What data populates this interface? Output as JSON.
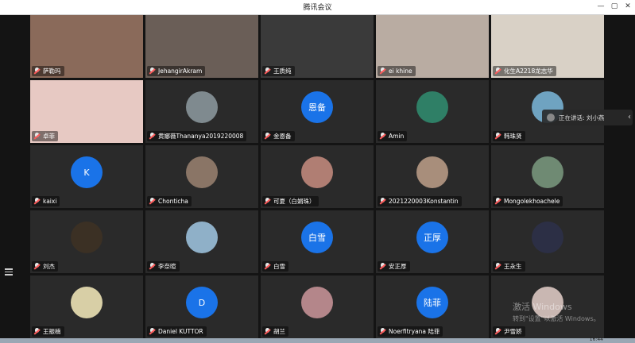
{
  "window": {
    "title": "腾讯会议",
    "min": "—",
    "max": "▢",
    "close": "✕"
  },
  "speaking": {
    "label": "正在讲话: 刘小燕"
  },
  "watermark": {
    "line1": "激活 Windows",
    "line2": "转到\"设置\"以激活 Windows。"
  },
  "clock": "16:44",
  "participants": [
    {
      "name": "萨勒玛",
      "kind": "video",
      "bg": "#8a6a5a"
    },
    {
      "name": "JehangirAkram",
      "kind": "video",
      "bg": "#6a5e57"
    },
    {
      "name": "王质纯",
      "kind": "video",
      "bg": "#3a3a3a"
    },
    {
      "name": "ei khine",
      "kind": "video",
      "bg": "#b9aca2"
    },
    {
      "name": "化生A2218龙志华",
      "kind": "video",
      "bg": "#d9d1c6"
    },
    {
      "name": "卓菲",
      "kind": "video",
      "bg": "#e7c9c3"
    },
    {
      "name": "黄娜薇Thananya2019220008",
      "kind": "photo",
      "color": "#7f8a8f"
    },
    {
      "name": "金恩备",
      "kind": "text",
      "text": "恩备"
    },
    {
      "name": "Amin",
      "kind": "photo",
      "color": "#2f7f66"
    },
    {
      "name": "韩珠贤",
      "kind": "photo",
      "color": "#6fa3c1"
    },
    {
      "name": "kaixi",
      "kind": "text",
      "text": "K"
    },
    {
      "name": "Chonticha",
      "kind": "photo",
      "color": "#8a7566"
    },
    {
      "name": "可夏（白娟珠）",
      "kind": "photo",
      "color": "#b07e73"
    },
    {
      "name": "2021220003Konstantin",
      "kind": "photo",
      "color": "#a88e7b"
    },
    {
      "name": "Mongolekhoachele",
      "kind": "photo",
      "color": "#6f8a73"
    },
    {
      "name": "刘杰",
      "kind": "photo",
      "color": "#3b3024"
    },
    {
      "name": "李奈暄",
      "kind": "photo",
      "color": "#8fb0c8"
    },
    {
      "name": "白雪",
      "kind": "text",
      "text": "白雪"
    },
    {
      "name": "安正厚",
      "kind": "text",
      "text": "正厚"
    },
    {
      "name": "王永生",
      "kind": "photo",
      "color": "#2c2f45"
    },
    {
      "name": "王振楠",
      "kind": "photo",
      "color": "#d8cfa6"
    },
    {
      "name": "Daniel KUTTOR",
      "kind": "text",
      "text": "D"
    },
    {
      "name": "胡兰",
      "kind": "photo",
      "color": "#b4868a"
    },
    {
      "name": "Noerfitryana 陆菲",
      "kind": "text",
      "text": "陆菲"
    },
    {
      "name": "尹雪娇",
      "kind": "photo",
      "color": "#c9b7b2"
    }
  ]
}
